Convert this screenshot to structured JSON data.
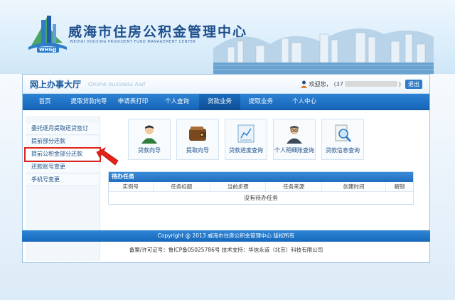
{
  "banner": {
    "logo_title": "威海市住房公积金管理中心",
    "logo_sub": "WEIHAI HOUSING PROVIDENT FUND MANAGEMENT CENTER",
    "logo_abbr": "WHGJJ"
  },
  "header": {
    "title": "网上办事大厅",
    "subtitle": "Online business hall",
    "welcome": "欢迎您，",
    "open_paren": "(",
    "id_prefix": "37",
    "close_paren": ")",
    "logout": "退出"
  },
  "nav": {
    "items": [
      {
        "label": "首页"
      },
      {
        "label": "提取贷款向导"
      },
      {
        "label": "申请表打印"
      },
      {
        "label": "个人查询"
      },
      {
        "label": "贷款业务"
      },
      {
        "label": "提取业务"
      },
      {
        "label": "个人中心"
      }
    ],
    "active_index": 4
  },
  "sidebar": {
    "items": [
      {
        "label": "委托逐月提取还贷签订"
      },
      {
        "label": "提前部分还款"
      },
      {
        "label": "提前公积金部分还款"
      },
      {
        "label": "还款账号变更"
      },
      {
        "label": "手机号变更"
      }
    ],
    "highlighted_index": 2
  },
  "quick_links": [
    {
      "label": "贷款向导",
      "icon": "advisor-person-icon"
    },
    {
      "label": "提取向导",
      "icon": "wallet-icon"
    },
    {
      "label": "贷款进度查询",
      "icon": "chart-document-icon"
    },
    {
      "label": "个人明细账查询",
      "icon": "person-glasses-icon"
    },
    {
      "label": "贷款信息查询",
      "icon": "magnifier-document-icon"
    }
  ],
  "tasks": {
    "title": "待办任务",
    "columns": [
      "实例号",
      "任务标题",
      "当前步骤",
      "任务来源",
      "创建时间",
      "解锁"
    ],
    "empty_text": "没有待办任务"
  },
  "footer": {
    "copyright": "Copyright @ 2013 威海市住房公积金管理中心 版权所有",
    "info": "备案/许可证号：鲁ICP备05025786号 技术支持：华信永道（北京）科技有限公司"
  },
  "colors": {
    "nav_blue": "#1f72c4",
    "title_blue": "#1c5b9c",
    "highlight_red": "#e2231a"
  }
}
